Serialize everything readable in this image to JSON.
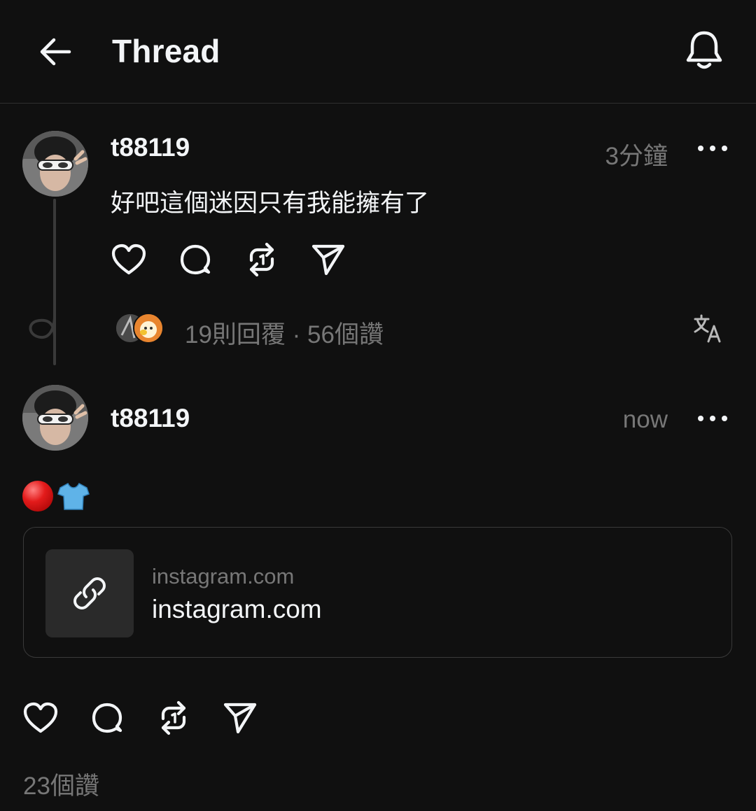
{
  "header": {
    "title": "Thread"
  },
  "posts": [
    {
      "username": "t88119",
      "time": "3分鐘",
      "text": "好吧這個迷因只有我能擁有了",
      "stats": "19則回覆 · 56個讚"
    },
    {
      "username": "t88119",
      "time": "now",
      "emojis": "🔴👕",
      "link": {
        "domain": "instagram.com",
        "title": "instagram.com"
      },
      "stats": "23個讚"
    }
  ],
  "icons": {
    "back": "arrow-left-icon",
    "bell": "bell-icon",
    "more": "more-icon",
    "like": "heart-icon",
    "reply": "comment-icon",
    "repost": "repost-icon",
    "share": "send-icon",
    "translate": "translate-icon",
    "link": "link-icon"
  },
  "colors": {
    "background": "#101010",
    "text": "#f3f5f7",
    "muted": "#777777",
    "border": "#3a3a3a"
  }
}
